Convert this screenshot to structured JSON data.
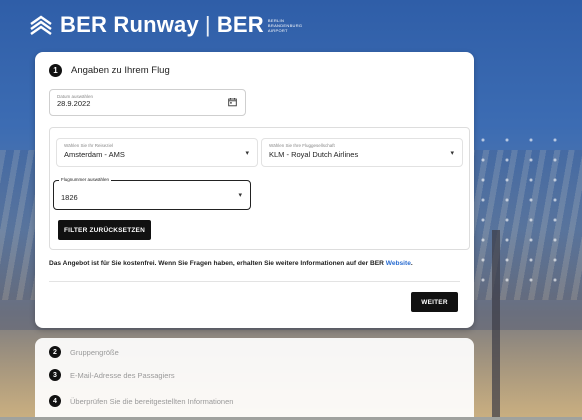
{
  "brand": {
    "name": "BER Runway",
    "separator": "|",
    "mark": "BER",
    "mark_small": [
      "BERLIN",
      "BRANDENBURG",
      "AIRPORT"
    ]
  },
  "step1": {
    "number": "1",
    "title": "Angaben zu Ihrem Flug",
    "date": {
      "label": "Datum auswählen",
      "value": "28.9.2022"
    },
    "destination": {
      "label": "Wählen Sie Ihr Reiseziel",
      "value": "Amsterdam - AMS"
    },
    "airline": {
      "label": "Wählen Sie Ihre Fluggesellschaft",
      "value": "KLM - Royal Dutch Airlines"
    },
    "flight": {
      "label": "Flugnummer auswählen",
      "value": "1826"
    },
    "reset_label": "FILTER ZURÜCKSETZEN",
    "info_text": "Das Angebot ist für Sie kostenfrei. Wenn Sie Fragen haben, erhalten Sie weitere Informationen auf der BER ",
    "info_link": "Website",
    "info_end": ".",
    "next_label": "WEITER"
  },
  "steps": [
    {
      "number": "2",
      "title": "Gruppengröße"
    },
    {
      "number": "3",
      "title": "E-Mail-Adresse des Passagiers"
    },
    {
      "number": "4",
      "title": "Überprüfen Sie die bereitgestellten Informationen"
    }
  ]
}
